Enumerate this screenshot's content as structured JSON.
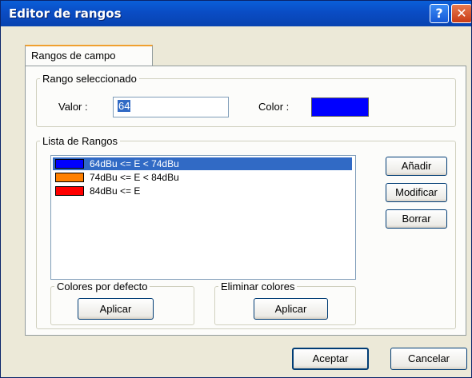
{
  "window": {
    "title": "Editor de rangos",
    "help_label": "?",
    "close_label": "✕"
  },
  "tab": {
    "label": "Rangos de campo"
  },
  "selected_range": {
    "legend": "Rango seleccionado",
    "value_label": "Valor :",
    "value": "64",
    "color_label": "Color :",
    "color": "#0000ff"
  },
  "ranges": {
    "legend": "Lista de Rangos",
    "items": [
      {
        "label": "64dBu <= E < 74dBu",
        "color": "#0000ff",
        "selected": true
      },
      {
        "label": "74dBu <= E < 84dBu",
        "color": "#ff8000",
        "selected": false
      },
      {
        "label": "84dBu <= E",
        "color": "#ff0000",
        "selected": false
      }
    ],
    "add_label": "Añadir",
    "modify_label": "Modificar",
    "delete_label": "Borrar"
  },
  "default_colors": {
    "legend": "Colores por defecto",
    "apply_label": "Aplicar"
  },
  "remove_colors": {
    "legend": "Eliminar colores",
    "apply_label": "Aplicar"
  },
  "footer": {
    "accept_label": "Aceptar",
    "cancel_label": "Cancelar"
  }
}
